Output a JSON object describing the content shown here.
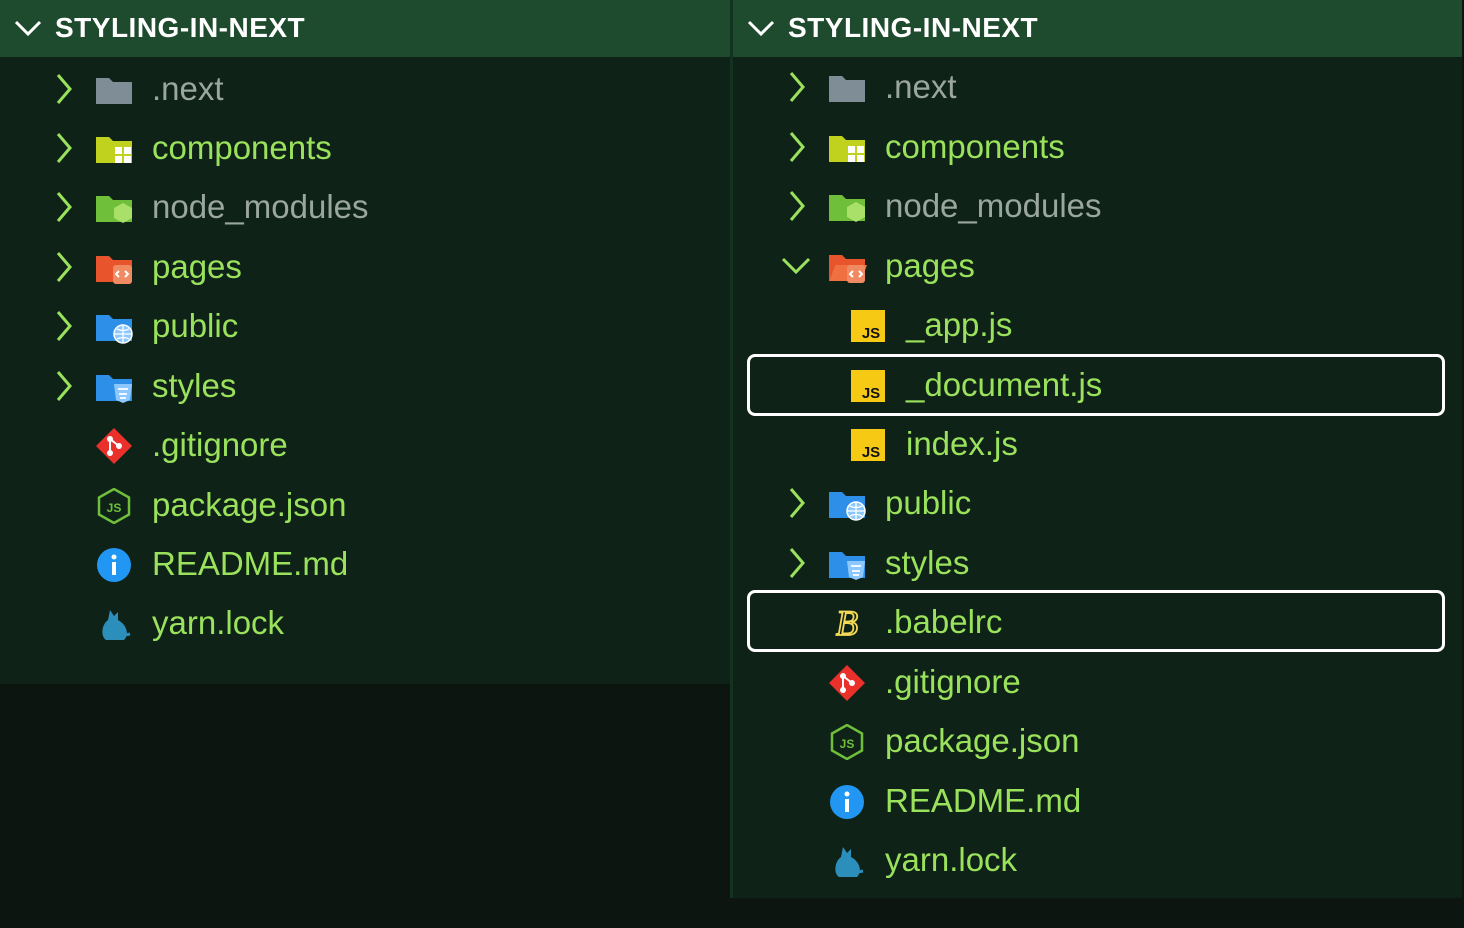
{
  "left": {
    "header": "STYLING-IN-NEXT",
    "items": [
      {
        "label": ".next",
        "icon": "folder-gray-icon",
        "expandable": true
      },
      {
        "label": "components",
        "icon": "folder-components-icon",
        "expandable": true
      },
      {
        "label": "node_modules",
        "icon": "folder-node-icon",
        "expandable": true
      },
      {
        "label": "pages",
        "icon": "folder-pages-icon",
        "expandable": true
      },
      {
        "label": "public",
        "icon": "folder-public-icon",
        "expandable": true
      },
      {
        "label": "styles",
        "icon": "folder-styles-icon",
        "expandable": true
      },
      {
        "label": ".gitignore",
        "icon": "git-icon",
        "expandable": false
      },
      {
        "label": "package.json",
        "icon": "nodejs-icon",
        "expandable": false
      },
      {
        "label": "README.md",
        "icon": "info-icon",
        "expandable": false
      },
      {
        "label": "yarn.lock",
        "icon": "yarn-icon",
        "expandable": false
      }
    ]
  },
  "right": {
    "header": "STYLING-IN-NEXT",
    "items": [
      {
        "label": ".next",
        "icon": "folder-gray-icon",
        "expandable": true
      },
      {
        "label": "components",
        "icon": "folder-components-icon",
        "expandable": true
      },
      {
        "label": "node_modules",
        "icon": "folder-node-icon",
        "expandable": true
      },
      {
        "label": "pages",
        "icon": "folder-pages-open-icon",
        "expanded": true
      },
      {
        "label": "_app.js",
        "icon": "javascript-icon"
      },
      {
        "label": "_document.js",
        "icon": "javascript-icon",
        "highlighted": true
      },
      {
        "label": "index.js",
        "icon": "javascript-icon"
      },
      {
        "label": "public",
        "icon": "folder-public-icon",
        "expandable": true
      },
      {
        "label": "styles",
        "icon": "folder-styles-icon",
        "expandable": true
      },
      {
        "label": ".babelrc",
        "icon": "babel-icon",
        "highlighted": true
      },
      {
        "label": ".gitignore",
        "icon": "git-icon"
      },
      {
        "label": "package.json",
        "icon": "nodejs-icon"
      },
      {
        "label": "README.md",
        "icon": "info-icon"
      },
      {
        "label": "yarn.lock",
        "icon": "yarn-icon"
      }
    ]
  },
  "colors": {
    "panel_bg": "#0f2218",
    "header_bg": "#1e4b2d",
    "label_green": "#9be25c",
    "label_gray": "#9aa6a0",
    "highlight_border": "#ffffff"
  }
}
